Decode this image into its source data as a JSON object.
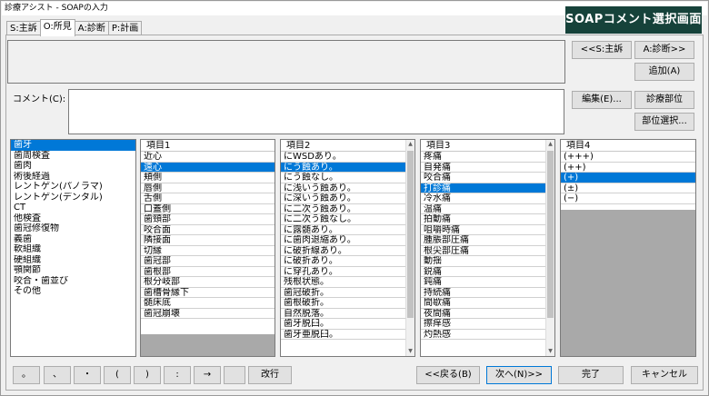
{
  "window": {
    "title": "診療アシスト - SOAPの入力"
  },
  "banner": "SOAPコメント選択画面",
  "tabs": [
    "S:主訴",
    "O:所見",
    "A:診断",
    "P:計画"
  ],
  "buttons": {
    "prev_s": "<<S:主訴",
    "next_a": "A:診断>>",
    "add": "追加(A)",
    "edit": "編集(E)...",
    "treat_site": "診療部位",
    "site_select": "部位選択..."
  },
  "comment": {
    "label": "コメント(C):",
    "value": ""
  },
  "category_list": {
    "items": [
      "歯牙",
      "歯周検査",
      "歯肉",
      "術後経過",
      "レントゲン(パノラマ)",
      "レントゲン(デンタル)",
      "CT",
      "他検査",
      "歯冠修復物",
      "義歯",
      "軟組織",
      "硬組織",
      "顎関節",
      "咬合・歯並び",
      "その他"
    ],
    "selected_index": 0
  },
  "col1": {
    "header": "項目1",
    "items": [
      "近心",
      "遠心",
      "頬側",
      "唇側",
      "舌側",
      "口蓋側",
      "歯頸部",
      "咬合面",
      "隣接面",
      "切縁",
      "歯冠部",
      "歯根部",
      "根分岐部",
      "歯槽骨縁下",
      "髄床底",
      "歯冠崩壊"
    ],
    "selected_index": 1
  },
  "col2": {
    "header": "項目2",
    "items": [
      "にWSDあり。",
      "にう蝕あり。",
      "にう蝕なし。",
      "に浅いう蝕あり。",
      "に深いう蝕あり。",
      "に二次う蝕あり。",
      "に二次う蝕なし。",
      "に露髄あり。",
      "に歯肉退縮あり。",
      "に破折線あり。",
      "に破折あり。",
      "に穿孔あり。",
      "残根状態。",
      "歯冠破折。",
      "歯根破折。",
      "自然脱落。",
      "歯牙脱臼。",
      "歯牙亜脱臼。"
    ],
    "selected_index": 1
  },
  "col3": {
    "header": "項目3",
    "items": [
      "疼痛",
      "自発痛",
      "咬合痛",
      "打診痛",
      "冷水痛",
      "温痛",
      "拍動痛",
      "咀嚼時痛",
      "腫脹部圧痛",
      "根尖部圧痛",
      "動揺",
      "鋭痛",
      "鈍痛",
      "持続痛",
      "間歇痛",
      "夜間痛",
      "擦痒感",
      "灼熱感"
    ],
    "selected_index": 3
  },
  "col4": {
    "header": "項目4",
    "items": [
      "(+++)",
      "(++)",
      "(+)",
      "(±)",
      "(−)"
    ],
    "selected_index": 2
  },
  "symbols": [
    "。",
    "、",
    "・",
    "(",
    ")",
    ":",
    "→",
    "",
    "改行"
  ],
  "nav": {
    "back": "<<戻る(B)",
    "next": "次へ(N)>>",
    "done": "完了",
    "cancel": "キャンセル"
  }
}
